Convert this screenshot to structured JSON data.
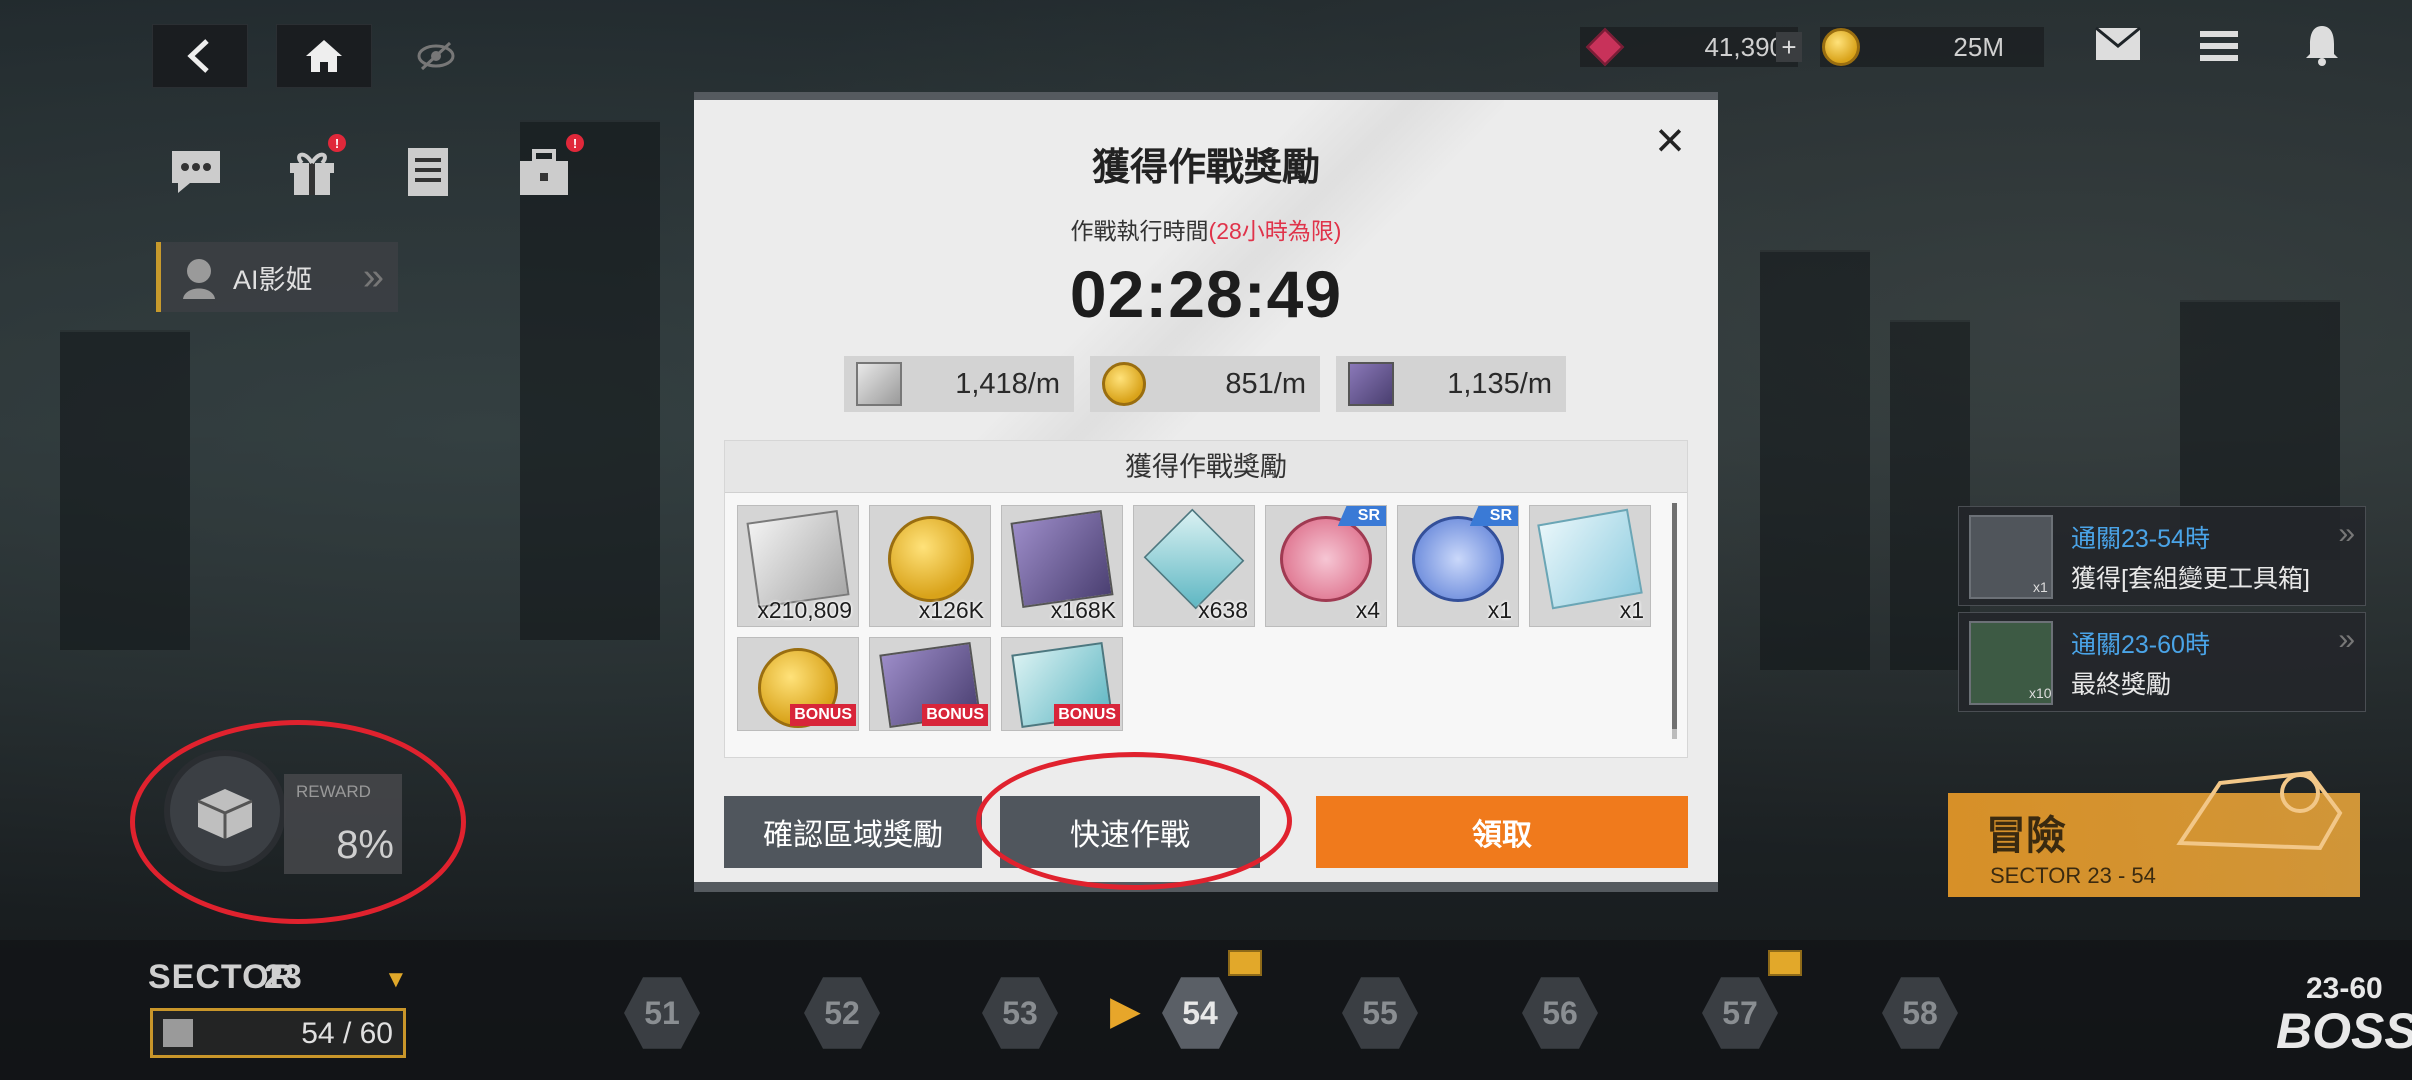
{
  "top_bar": {
    "gems": "41,390",
    "gems_plus": "+",
    "credits": "25M"
  },
  "sidebar": {
    "ai_button_label": "AI影姬",
    "ai_button_chevron": "»"
  },
  "reward_gauge": {
    "label": "REWARD",
    "percent": "8%"
  },
  "sector": {
    "label": "SECTOR",
    "number": "23",
    "progress_text": "54 / 60",
    "stages": [
      "51",
      "52",
      "53",
      "54",
      "55",
      "56",
      "57",
      "58"
    ],
    "current_stage": "54",
    "boss_label": "23-60",
    "boss_text": "BOSS"
  },
  "quests": [
    {
      "title": "通關23-54時",
      "desc": "獲得[套組變更工具箱]",
      "qty": "x1"
    },
    {
      "title": "通關23-60時",
      "desc": "最終獎勵",
      "qty": "x10"
    }
  ],
  "adventure": {
    "label": "冒險",
    "sub": "SECTOR 23 - 54"
  },
  "modal": {
    "title": "獲得作戰獎勵",
    "close": "×",
    "exec_label": "作戰執行時間",
    "exec_limit": "(28小時為限)",
    "timer": "02:28:49",
    "rates": [
      "1,418/m",
      "851/m",
      "1,135/m"
    ],
    "reward_header": "獲得作戰獎勵",
    "items": [
      {
        "qty": "x210,809",
        "kind": "exp-book"
      },
      {
        "qty": "x126K",
        "kind": "credit"
      },
      {
        "qty": "x168K",
        "kind": "core-dust"
      },
      {
        "qty": "x638",
        "kind": "battle-data"
      },
      {
        "qty": "x4",
        "kind": "sr-pink",
        "tag": "SR"
      },
      {
        "qty": "x1",
        "kind": "sr-blue",
        "tag": "SR"
      },
      {
        "qty": "x1",
        "kind": "module-box"
      },
      {
        "kind": "credit",
        "tag": "BONUS"
      },
      {
        "kind": "core-dust",
        "tag": "BONUS"
      },
      {
        "kind": "battle-data",
        "tag": "BONUS"
      }
    ],
    "btn_confirm": "確認區域獎勵",
    "btn_quick": "快速作戰",
    "btn_claim": "領取"
  },
  "colors": {
    "accent_orange": "#f07a1c",
    "highlight_red": "#e0222e",
    "link_blue": "#4aa4e8"
  }
}
